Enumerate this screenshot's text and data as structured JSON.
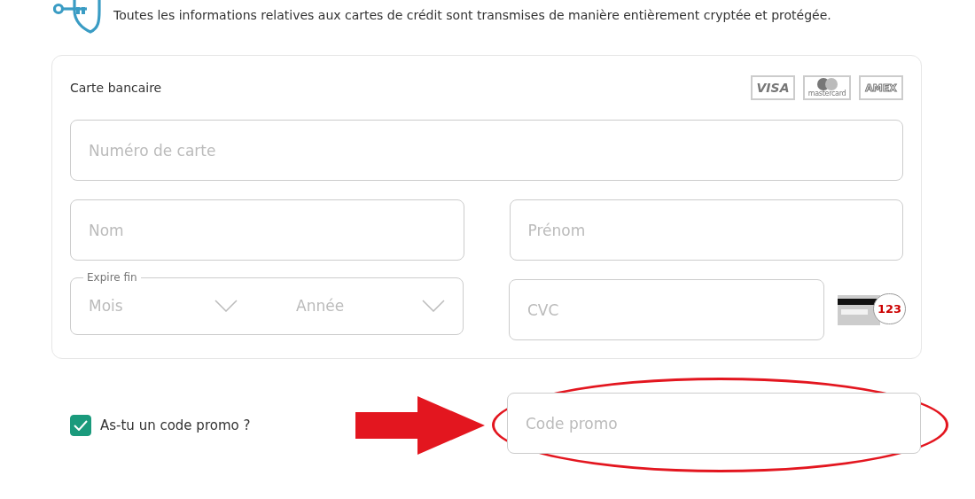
{
  "security_note": "Toutes les informations relatives aux cartes de crédit sont transmises de manière entièrement cryptée et protégée.",
  "card_panel": {
    "title": "Carte bancaire",
    "card_logos": [
      {
        "kind": "visa",
        "text": "VISA"
      },
      {
        "kind": "mastercard",
        "text": "mastercard"
      },
      {
        "kind": "amex",
        "text": "AMEX"
      }
    ],
    "card_number": {
      "placeholder": "Numéro de carte"
    },
    "last_name": {
      "placeholder": "Nom"
    },
    "first_name": {
      "placeholder": "Prénom"
    },
    "expiry": {
      "legend": "Expire fin",
      "month": {
        "placeholder": "Mois"
      },
      "year": {
        "placeholder": "Année"
      }
    },
    "cvc": {
      "placeholder": "CVC",
      "hint_digits": "123"
    }
  },
  "promo": {
    "checkbox_label": "As-tu un code promo ?",
    "checked": true,
    "field": {
      "placeholder": "Code promo"
    },
    "highlighted": true
  }
}
